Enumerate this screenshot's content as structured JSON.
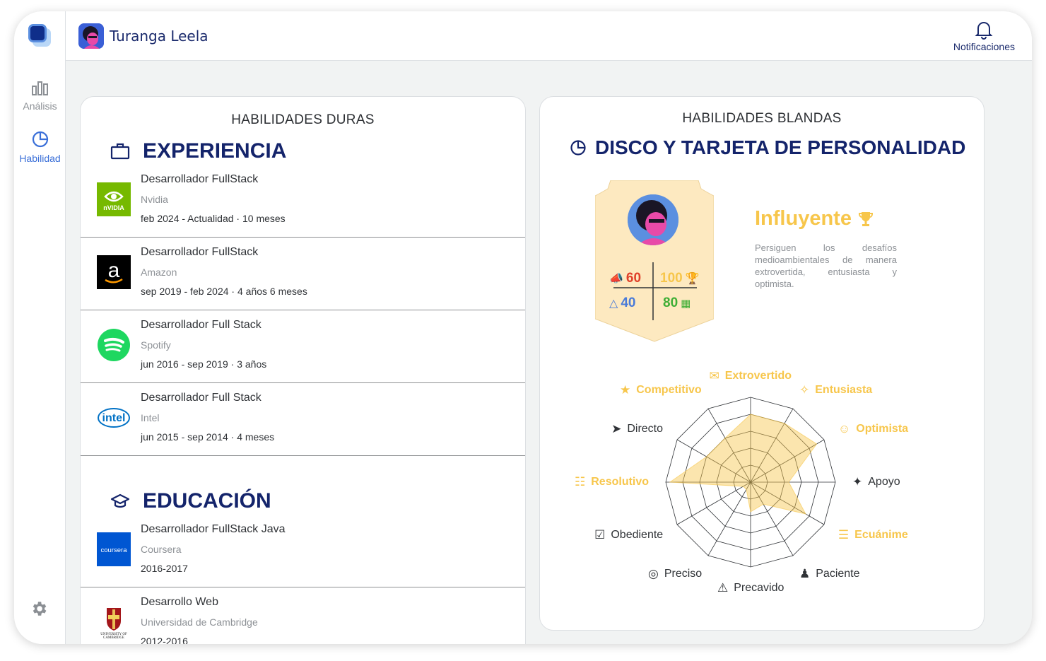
{
  "sidebar": {
    "items": [
      {
        "label": "Análisis",
        "icon": "bar-chart-icon"
      },
      {
        "label": "Habilidad",
        "icon": "pie-chart-icon"
      }
    ],
    "settings_icon": "gear-icon"
  },
  "header": {
    "username": "Turanga Leela",
    "notifications_label": "Notificaciones"
  },
  "hard_skills": {
    "title": "HABILIDADES DURAS",
    "experience_title": "EXPERIENCIA",
    "experience": [
      {
        "role": "Desarrollador FullStack",
        "company": "Nvidia",
        "period": "feb 2024 - Actualidad · 10 meses",
        "logo": "nvidia-logo"
      },
      {
        "role": "Desarrollador FullStack",
        "company": "Amazon",
        "period": "sep 2019 - feb 2024 · 4 años 6 meses",
        "logo": "amazon-logo"
      },
      {
        "role": "Desarrollador Full Stack",
        "company": "Spotify",
        "period": "jun 2016 - sep 2019 · 3 años",
        "logo": "spotify-logo"
      },
      {
        "role": "Desarrollador Full Stack",
        "company": "Intel",
        "period": "jun 2015 - sep 2014 · 4 meses",
        "logo": "intel-logo"
      }
    ],
    "education_title": "EDUCACIÓN",
    "education": [
      {
        "role": "Desarrollador FullStack Java",
        "company": "Coursera",
        "period": "2016-2017",
        "logo": "coursera-logo"
      },
      {
        "role": "Desarrollo Web",
        "company": "Universidad de Cambridge",
        "period": "2012-2016",
        "logo": "cambridge-logo"
      }
    ]
  },
  "soft_skills": {
    "title": "HABILIDADES BLANDAS",
    "disc_title": "DISCO Y TARJETA DE PERSONALIDAD",
    "personality": {
      "type": "Influyente",
      "description": "Persiguen los desafíos medioambientales de manera extrovertida, entusiasta y optimista."
    },
    "scores": [
      {
        "value": "60",
        "color": "#e0402a",
        "icon": "megaphone-icon"
      },
      {
        "value": "100",
        "color": "#f7c64b",
        "icon": "trophy-icon"
      },
      {
        "value": "40",
        "color": "#4a7bd8",
        "icon": "compass-icon"
      },
      {
        "value": "80",
        "color": "#3fae36",
        "icon": "puzzle-icon"
      }
    ],
    "colors": {
      "highlight": "#f7c64b",
      "navy": "#14246b"
    }
  },
  "chart_data": {
    "type": "radar",
    "categories": [
      "Extrovertido",
      "Entusiasta",
      "Optimista",
      "Apoyo",
      "Ecuánime",
      "Paciente",
      "Precavido",
      "Preciso",
      "Obediente",
      "Resolutivo",
      "Directo",
      "Competitivo"
    ],
    "highlighted": [
      "Extrovertido",
      "Entusiasta",
      "Optimista",
      "Ecuánime",
      "Resolutivo",
      "Competitivo"
    ],
    "values": [
      0.8,
      0.8,
      0.9,
      0.45,
      0.75,
      0.3,
      0.35,
      0.1,
      0.1,
      0.95,
      0.6,
      0.6
    ],
    "max": 1,
    "rings": 5,
    "fill_color": "#f7c64b"
  }
}
